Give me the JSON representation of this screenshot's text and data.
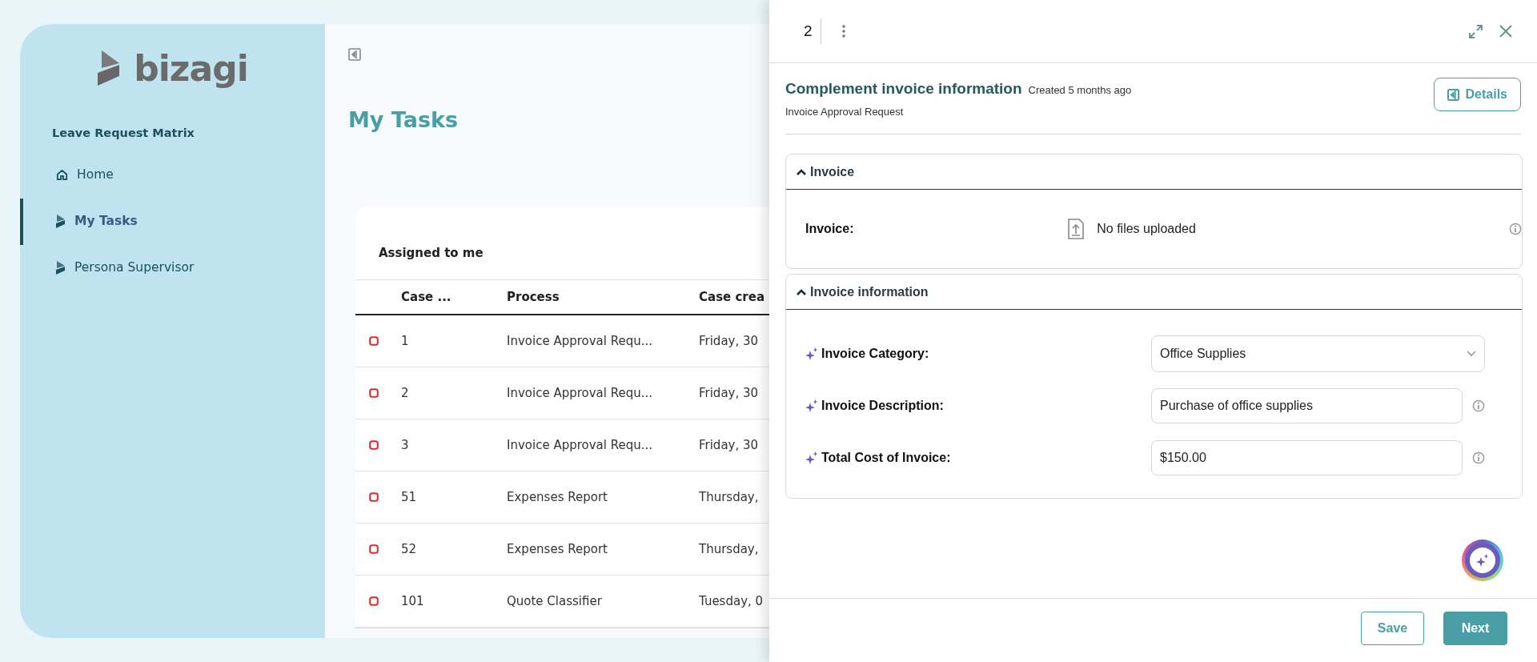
{
  "sidebar": {
    "logo": "bizagi",
    "app_title": "Leave Request Matrix",
    "items": [
      {
        "label": "Home",
        "selected": false
      },
      {
        "label": "My Tasks",
        "selected": true
      },
      {
        "label": "Persona Supervisor",
        "selected": false
      }
    ]
  },
  "main": {
    "title": "My Tasks",
    "table": {
      "title": "Assigned to me",
      "columns": [
        "Case ...",
        "Process",
        "Case crea"
      ],
      "rows": [
        {
          "cells": [
            "1",
            "Invoice Approval Requ...",
            "Friday, 30"
          ]
        },
        {
          "cells": [
            "2",
            "Invoice Approval Requ...",
            "Friday, 30"
          ]
        },
        {
          "cells": [
            "3",
            "Invoice Approval Requ...",
            "Friday, 30"
          ]
        },
        {
          "cells": [
            "51",
            "Expenses Report",
            "Thursday,"
          ]
        },
        {
          "cells": [
            "52",
            "Expenses Report",
            "Thursday,"
          ]
        },
        {
          "cells": [
            "101",
            "Quote Classifier",
            "Tuesday, 0"
          ]
        }
      ]
    }
  },
  "panel": {
    "case_number": "2",
    "title": "Complement invoice information",
    "created": "Created 5 months ago",
    "subtitle": "Invoice Approval Request",
    "details_button": "Details",
    "sections": [
      {
        "title": "Invoice",
        "expanded": true,
        "fields": [
          {
            "kind": "file",
            "label": "Invoice:",
            "ai": false,
            "value": "No files uploaded",
            "info": true
          }
        ]
      },
      {
        "title": "Invoice information",
        "expanded": true,
        "fields": [
          {
            "kind": "select",
            "label": "Invoice Category:",
            "ai": true,
            "value": "Office Supplies",
            "info": false
          },
          {
            "kind": "text",
            "label": "Invoice Description:",
            "ai": true,
            "value": "Purchase of office supplies",
            "info": true
          },
          {
            "kind": "text",
            "label": "Total Cost of Invoice:",
            "ai": true,
            "value": "$150.00",
            "info": true
          }
        ]
      }
    ],
    "buttons": [
      {
        "label": "Save",
        "kind": "secondary"
      },
      {
        "label": "Next",
        "kind": "primary"
      }
    ]
  }
}
